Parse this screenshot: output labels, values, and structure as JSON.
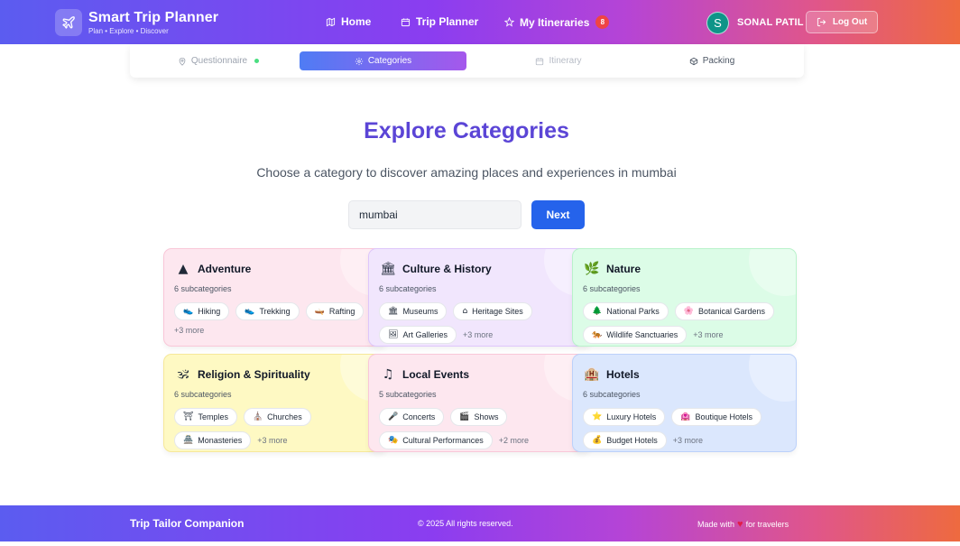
{
  "header": {
    "brand_title": "Smart Trip Planner",
    "brand_subtitle": "Plan • Explore • Discover",
    "nav": {
      "home": "Home",
      "trip_planner": "Trip Planner",
      "my_itineraries": "My Itineraries",
      "itineraries_count": "8"
    },
    "user_initial": "S",
    "user_name": "SONAL PATIL",
    "logout_label": "Log Out"
  },
  "steps": {
    "questionnaire": "Questionnaire",
    "categories": "Categories",
    "itinerary": "Itinerary",
    "packing": "Packing"
  },
  "main": {
    "title": "Explore Categories",
    "subtitle": "Choose a category to discover amazing places and experiences in mumbai",
    "search_value": "mumbai",
    "next_label": "Next"
  },
  "categories": [
    {
      "emoji": "▲",
      "title": "Adventure",
      "count": "6 subcategories",
      "chips": [
        {
          "e": "👟",
          "t": "Hiking"
        },
        {
          "e": "👟",
          "t": "Trekking"
        },
        {
          "e": "🛶",
          "t": "Rafting"
        }
      ],
      "more": "+3 more"
    },
    {
      "emoji": "🏛",
      "title": "Culture & History",
      "count": "6 subcategories",
      "chips": [
        {
          "e": "🏛",
          "t": "Museums"
        },
        {
          "e": "⌂",
          "t": "Heritage Sites"
        },
        {
          "e": "🖼",
          "t": "Art Galleries"
        }
      ],
      "more": "+3 more"
    },
    {
      "emoji": "🌿",
      "title": "Nature",
      "count": "6 subcategories",
      "chips": [
        {
          "e": "🌲",
          "t": "National Parks"
        },
        {
          "e": "🌸",
          "t": "Botanical Gardens"
        },
        {
          "e": "🐅",
          "t": "Wildlife Sanctuaries"
        }
      ],
      "more": "+3 more"
    },
    {
      "emoji": "🕉",
      "title": "Religion & Spirituality",
      "count": "6 subcategories",
      "chips": [
        {
          "e": "⛩",
          "t": "Temples"
        },
        {
          "e": "⛪",
          "t": "Churches"
        },
        {
          "e": "🏯",
          "t": "Monasteries"
        }
      ],
      "more": "+3 more"
    },
    {
      "emoji": "♫",
      "title": "Local Events",
      "count": "5 subcategories",
      "chips": [
        {
          "e": "🎤",
          "t": "Concerts"
        },
        {
          "e": "🎬",
          "t": "Shows"
        },
        {
          "e": "🎭",
          "t": "Cultural Performances"
        }
      ],
      "more": "+2 more"
    },
    {
      "emoji": "🏨",
      "title": "Hotels",
      "count": "6 subcategories",
      "chips": [
        {
          "e": "⭐",
          "t": "Luxury Hotels"
        },
        {
          "e": "🏩",
          "t": "Boutique Hotels"
        },
        {
          "e": "💰",
          "t": "Budget Hotels"
        }
      ],
      "more": "+3 more"
    }
  ],
  "footer": {
    "left": "Trip Tailor Companion",
    "middle": "© 2025 All rights reserved.",
    "right_prefix": "Made with",
    "heart": "♥",
    "right_suffix": "for travelers"
  }
}
